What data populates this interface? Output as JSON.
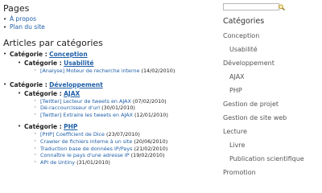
{
  "pages": {
    "title": "Pages",
    "items": [
      "À propos",
      "Plan du site"
    ]
  },
  "articles": {
    "title": "Articles par catégories",
    "prefix": "Catégorie :",
    "categories": [
      {
        "name": "Conception",
        "subcategories": [
          {
            "name": "Usabilité",
            "posts": [
              {
                "title": "[Analyse] Moteur de recherche interne",
                "date": "(14/02/2010)"
              }
            ]
          }
        ]
      },
      {
        "name": "Développement",
        "subcategories": [
          {
            "name": "AJAX",
            "posts": [
              {
                "title": "[Twitter] Lecteur de tweets en AJAX",
                "date": "(07/02/2010)"
              },
              {
                "title": "Dé-raccourcisseur d'url",
                "date": "(30/01/2010)"
              },
              {
                "title": "[Twitter] Extraire les tweets en AJAX",
                "date": "(12/01/2010)"
              }
            ]
          },
          {
            "name": "PHP",
            "posts": [
              {
                "title": "[PHP] Coefficient de Dice",
                "date": "(23/07/2010)"
              },
              {
                "title": "Crawler de fichiers interne à un site",
                "date": "(20/06/2010)"
              },
              {
                "title": "Traduction base de données IP/Pays",
                "date": "(21/02/2010)"
              },
              {
                "title": "Connaître le pays d'une adresse IP",
                "date": "(19/02/2010)"
              },
              {
                "title": "API de Untiny",
                "date": "(31/01/2010)"
              }
            ]
          }
        ]
      }
    ]
  },
  "sidebar": {
    "search_placeholder": "",
    "search_icon": "magnifier-icon",
    "categories_title": "Catégories",
    "categories": [
      {
        "label": "Conception",
        "sub": false
      },
      {
        "label": "Usabilité",
        "sub": true
      },
      {
        "label": "Développement",
        "sub": false
      },
      {
        "label": "AJAX",
        "sub": true
      },
      {
        "label": "PHP",
        "sub": true
      },
      {
        "label": "Gestion de projet",
        "sub": false
      },
      {
        "label": "Gestion de site web",
        "sub": false
      },
      {
        "label": "Lecture",
        "sub": false
      },
      {
        "label": "Livre",
        "sub": true
      },
      {
        "label": "Publication scientifique",
        "sub": true
      },
      {
        "label": "Promotion",
        "sub": false
      }
    ]
  },
  "colors": {
    "link": "#1f5fa8",
    "sidebar_text": "#555555"
  }
}
